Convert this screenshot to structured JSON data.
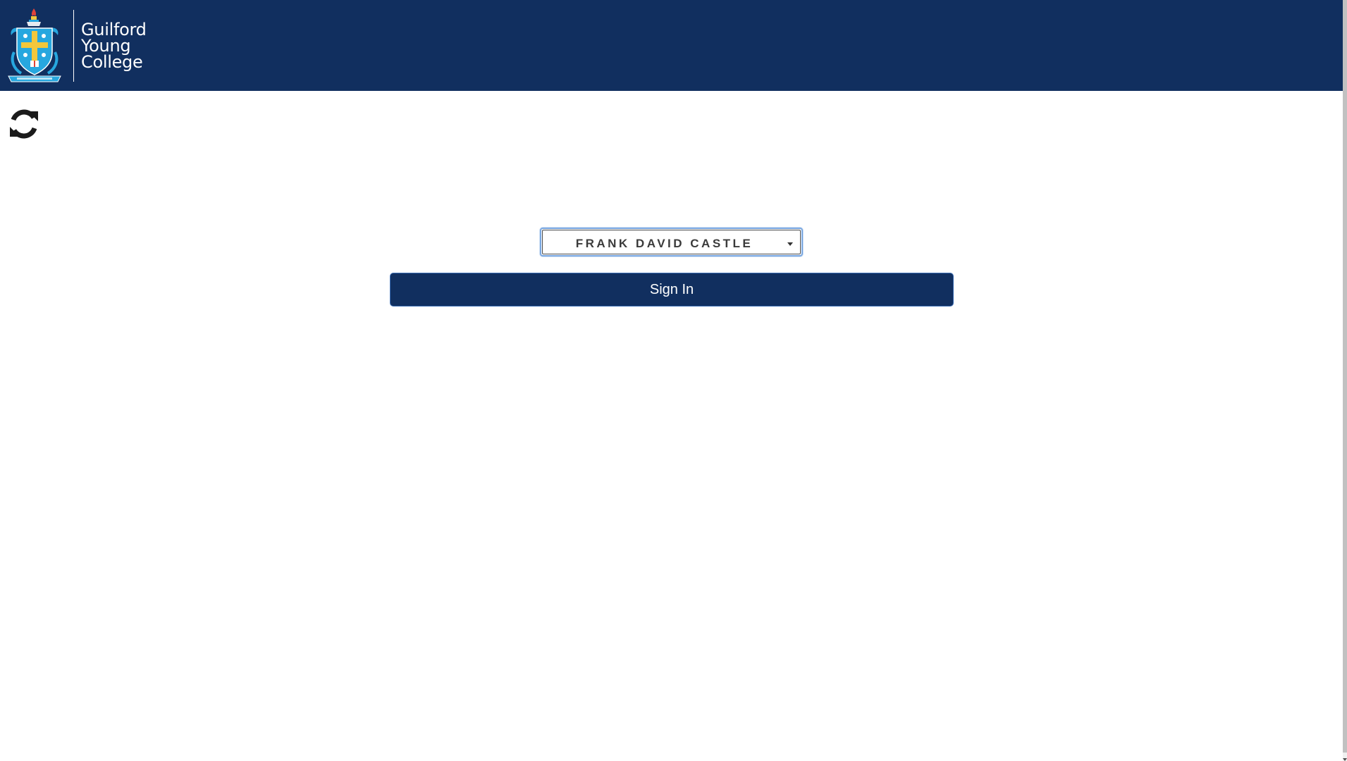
{
  "header": {
    "logo_lines": [
      "Guilford",
      "Young",
      "College"
    ],
    "background_color": "#112f5f"
  },
  "toolbar": {
    "refresh_icon": "refresh-icon"
  },
  "login": {
    "selected_user": "FRANK DAVID CASTLE",
    "sign_in_label": "Sign In"
  },
  "colors": {
    "brand_navy": "#112f5f",
    "crest_blue": "#27a7df",
    "crest_gold": "#f3c73b"
  }
}
